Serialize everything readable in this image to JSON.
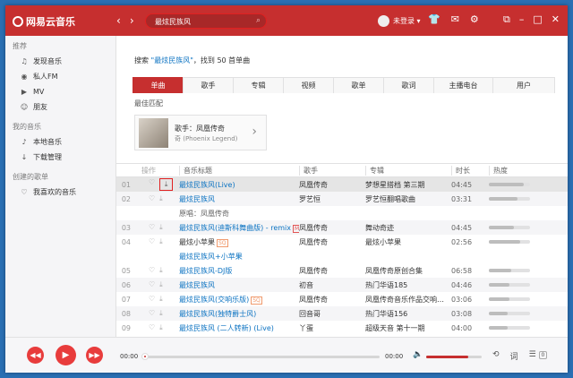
{
  "app": {
    "logo_text": "网易云音乐"
  },
  "titlebar": {
    "back": "‹",
    "forward": "›",
    "search_value": "最炫民族风",
    "user_label": "未登录 ▾",
    "icons": [
      "skin-icon",
      "mail-icon",
      "settings-icon"
    ],
    "win_icons": [
      "mini-mode-icon",
      "minimize-icon",
      "maximize-icon",
      "close-icon"
    ]
  },
  "sidebar": {
    "sections": [
      {
        "head": "推荐",
        "items": [
          {
            "icon": "♫",
            "label": "发现音乐"
          },
          {
            "icon": "◉",
            "label": "私人FM"
          },
          {
            "icon": "▶",
            "label": "MV"
          },
          {
            "icon": "☺",
            "label": "朋友"
          }
        ]
      },
      {
        "head": "我的音乐",
        "items": [
          {
            "icon": "♪",
            "label": "本地音乐"
          },
          {
            "icon": "↓",
            "label": "下载管理"
          }
        ]
      },
      {
        "head": "创建的歌单",
        "items": [
          {
            "icon": "♡",
            "label": "我喜欢的音乐"
          }
        ]
      }
    ]
  },
  "search_result": {
    "prefix": "搜索 ",
    "keyword": "\"最炫民族风\"",
    "suffix": "，找到 50 首单曲"
  },
  "tabs": [
    "单曲",
    "歌手",
    "专辑",
    "视频",
    "歌单",
    "歌词",
    "主播电台",
    "用户"
  ],
  "best_match": {
    "label": "最佳匹配",
    "name": "歌手：凤凰传奇",
    "sub": "奇 (Phoenix Legend)"
  },
  "table": {
    "headers": [
      "操作",
      "音乐标题",
      "歌手",
      "专辑",
      "时长",
      "热度"
    ],
    "rows": [
      {
        "num": "01",
        "title": "最炫民族风(Live)",
        "artist": "凤凰传奇",
        "album": "梦想星搭档 第三期",
        "dur": "04:45",
        "heat": 0.85,
        "badge": "",
        "link": true
      },
      {
        "num": "02",
        "title": "最炫民族风",
        "artist": "罗艺恒",
        "album": "罗艺恒翻唱歌曲",
        "dur": "03:31",
        "heat": 0.7,
        "badge": "",
        "link": true,
        "sub": "原唱：凤凰传奇"
      },
      {
        "num": "03",
        "title": "最炫民族风(迪斯科舞曲版) - remix",
        "artist": "凤凰传奇",
        "album": "舞动奇迹",
        "dur": "04:45",
        "heat": 0.6,
        "badge": "MV",
        "link": true
      },
      {
        "num": "04",
        "title": "最炫小苹果",
        "artist": "凤凰传奇",
        "album": "最炫小苹果",
        "dur": "02:56",
        "heat": 0.75,
        "badge": "SQ",
        "link": false,
        "sub": "最炫民族风+小苹果"
      },
      {
        "num": "05",
        "title": "最炫民族风-DJ版",
        "artist": "凤凰传奇",
        "album": "凤凰传奇原创合集",
        "dur": "06:58",
        "heat": 0.55,
        "badge": "",
        "link": true
      },
      {
        "num": "06",
        "title": "最炫民族风",
        "artist": "初音",
        "album": "热门华语185",
        "dur": "04:46",
        "heat": 0.5,
        "badge": "",
        "link": true
      },
      {
        "num": "07",
        "title": "最炫民族风(交响乐版)",
        "artist": "凤凰传奇",
        "album": "凤凰传奇音乐作品交响…",
        "dur": "03:06",
        "heat": 0.5,
        "badge": "SQ",
        "link": true
      },
      {
        "num": "08",
        "title": "最炫民族风(独特爵士风)",
        "artist": "回音哥",
        "album": "热门华语156",
        "dur": "03:08",
        "heat": 0.45,
        "badge": "",
        "link": true
      },
      {
        "num": "09",
        "title": "最炫民族风 (二人转新) (Live)",
        "artist": "丫蛋",
        "album": "超级天音 第十一期",
        "dur": "04:00",
        "heat": 0.45,
        "badge": "",
        "link": true
      }
    ]
  },
  "player": {
    "time_current": "00:00",
    "time_total": "00:00",
    "progress": 0.0,
    "volume": 0.75,
    "playlist_count": "0"
  }
}
